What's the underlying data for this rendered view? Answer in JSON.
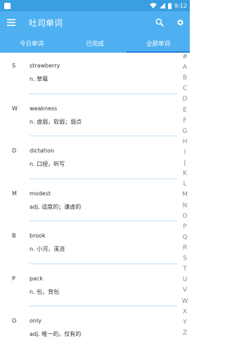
{
  "statusbar": {
    "time": "9:12"
  },
  "appbar": {
    "title": "吐司单词"
  },
  "tabs": [
    {
      "label": "今日单词",
      "active": false
    },
    {
      "label": "已完成",
      "active": false
    },
    {
      "label": "全部单词",
      "active": true
    }
  ],
  "words": [
    {
      "letter": "S",
      "word": "strawberry",
      "meaning": "n. 草莓"
    },
    {
      "letter": "W",
      "word": "weakness",
      "meaning": "n. 虚弱，软弱；弱点"
    },
    {
      "letter": "D",
      "word": "dictation",
      "meaning": "n. 口授，听写"
    },
    {
      "letter": "M",
      "word": "modest",
      "meaning": "adj. 适度的；谦虚的"
    },
    {
      "letter": "B",
      "word": "brook",
      "meaning": "n. 小河，溪流"
    },
    {
      "letter": "P",
      "word": "pack",
      "meaning": "n. 包，背包"
    },
    {
      "letter": "O",
      "word": "only",
      "meaning": "adj. 唯一的，仅有的"
    }
  ],
  "index": [
    "#",
    "A",
    "B",
    "C",
    "D",
    "E",
    "F",
    "G",
    "H",
    "I",
    "J",
    "K",
    "L",
    "M",
    "N",
    "O",
    "P",
    "Q",
    "R",
    "S",
    "T",
    "U",
    "V",
    "W",
    "X",
    "Y",
    "Z"
  ],
  "colors": {
    "statusbar": "#3a9fe0",
    "appbar": "#4eb0f0",
    "tab_indicator": "#1f7fd8",
    "divider": "#bfe0f7"
  }
}
